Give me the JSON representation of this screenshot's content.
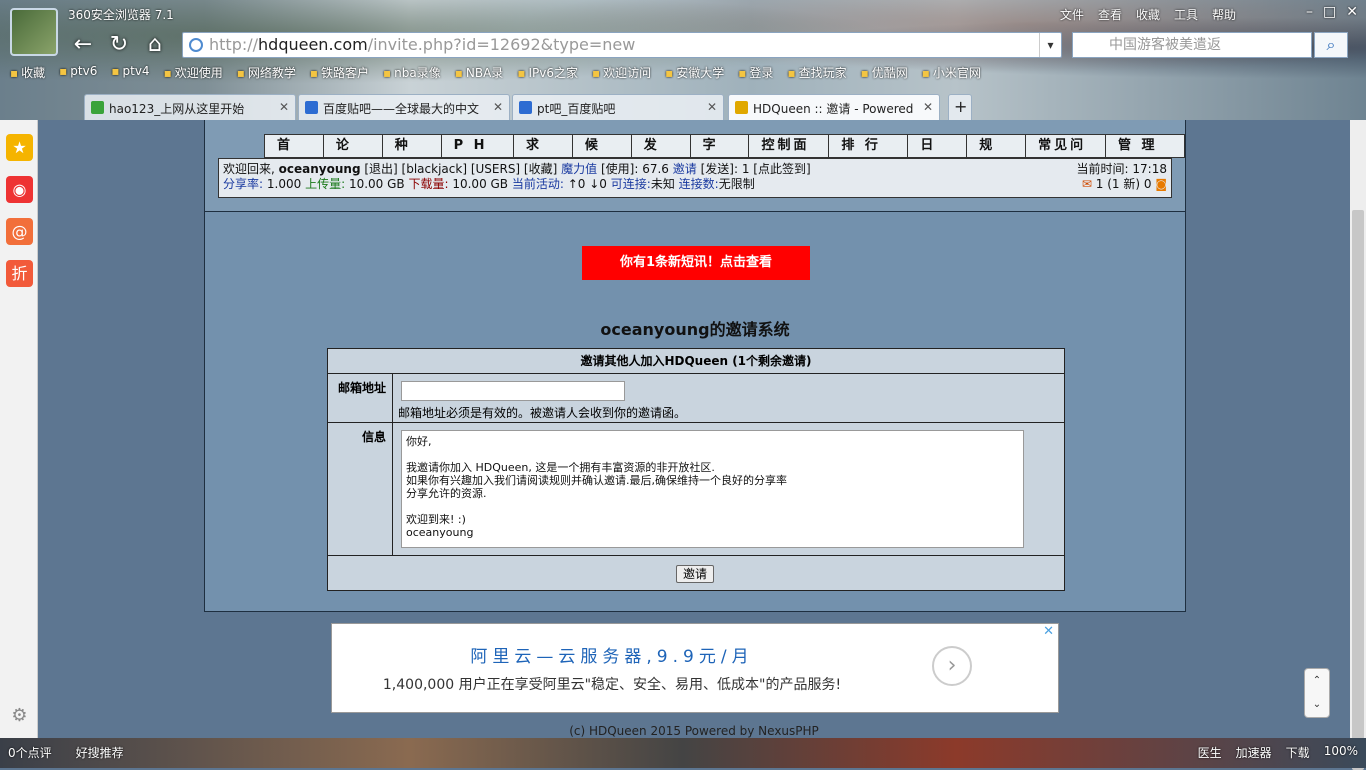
{
  "browser": {
    "title": "360安全浏览器 7.1",
    "menu": [
      "文件",
      "查看",
      "收藏",
      "工具",
      "帮助"
    ],
    "url_host": "hdqueen.com",
    "url_pre": "http://",
    "url_path": "/invite.php?id=12692&type=new",
    "search_placeholder": "中国游客被美遣返",
    "bookmarks": [
      "收藏",
      "ptv6",
      "ptv4",
      "欢迎使用",
      "网络教学",
      "铁路客户",
      "nba录像",
      "NBA录",
      "IPv6之家",
      "欢迎访问",
      "安徽大学",
      "登录",
      "查找玩家",
      "优酷网",
      "小米官网"
    ],
    "tabs": [
      "hao123_上网从这里开始",
      "百度贴吧——全球最大的中文",
      "pt吧_百度贴吧",
      "HDQueen :: 邀请 - Powered"
    ]
  },
  "menu": [
    "首 页",
    "论 坛",
    "种 子",
    "P H D",
    "求 片",
    "候 选",
    "发 布",
    "字 幕",
    "控制面板",
    "排 行 榜",
    "日 志",
    "规 则",
    "常见问题",
    "管 理 组"
  ],
  "info": {
    "welcome": "欢迎回来,",
    "user": "oceanyoung",
    "links": "[退出] [blackjack] [USERS] [收藏]",
    "bonus_label": "魔力值",
    "bonus": "[使用]: 67.6",
    "invite_label": "邀请",
    "invite": "[发送]: 1 [点此签到]",
    "ratio_label": "分享率:",
    "ratio": "1.000",
    "up_label": "上传量:",
    "up": "10.00 GB",
    "down_label": "下载量:",
    "down": "10.00 GB",
    "active_label": "当前活动:",
    "active": "↑0 ↓0",
    "conn_label": "可连接:",
    "conn": "未知",
    "conns_label": "连接数:",
    "conns": "无限制",
    "time": "当前时间: 17:18",
    "msgs": "1 (1 新)  0"
  },
  "notice": "你有1条新短讯！点击查看",
  "sys_title": "oceanyoung的邀请系统",
  "form": {
    "header": "邀请其他人加入HDQueen (1个剩余邀请)",
    "email_label": "邮箱地址",
    "email_value": "",
    "hint": "邮箱地址必须是有效的。被邀请人会收到你的邀请函。",
    "msg_label": "信息",
    "message": "你好,\n\n我邀请你加入 HDQueen, 这是一个拥有丰富资源的非开放社区.\n如果你有兴趣加入我们请阅读规则并确认邀请.最后,确保维持一个良好的分享率\n分享允许的资源.\n\n欢迎到来! :)\noceanyoung",
    "submit": "邀请"
  },
  "ad": {
    "title": "阿里云—云服务器,9.9元/月",
    "text": "1,400,000 用户正在享受阿里云\"稳定、安全、易用、低成本\"的产品服务!"
  },
  "footer": "(c) HDQueen 2015 Powered by NexusPHP",
  "status": {
    "left": [
      "0个点评",
      "好搜推荐"
    ],
    "right": [
      "医生",
      "加速器",
      "下载",
      "100%"
    ]
  }
}
